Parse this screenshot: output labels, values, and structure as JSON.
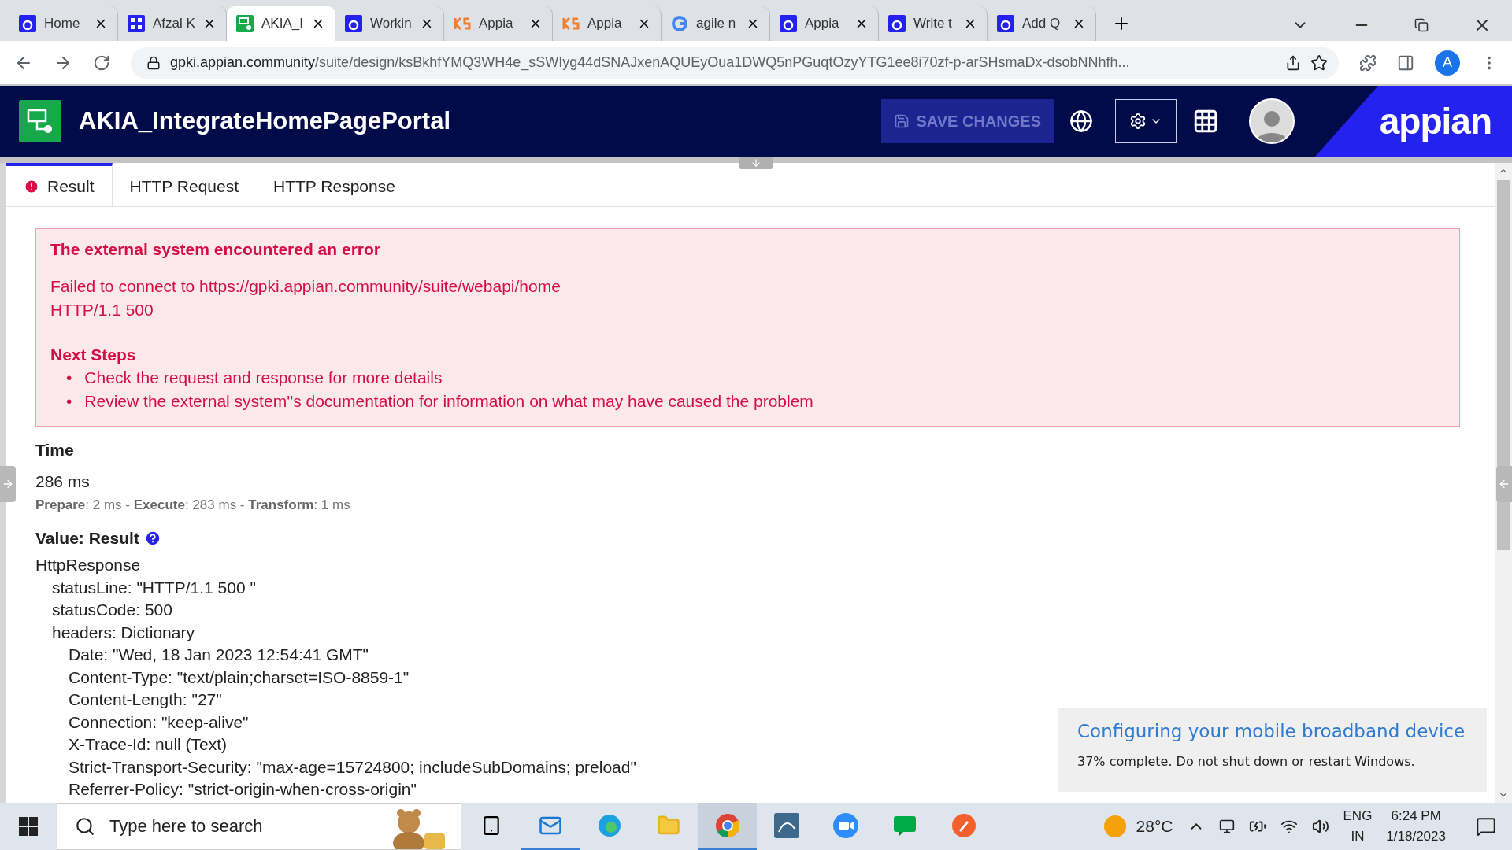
{
  "browser": {
    "tabs": [
      {
        "title": "Home",
        "selected": false,
        "kind": "appian"
      },
      {
        "title": "Afzal K",
        "selected": false,
        "kind": "grid"
      },
      {
        "title": "AKIA_I",
        "selected": true,
        "kind": "design"
      },
      {
        "title": "Workin",
        "selected": false,
        "kind": "appian"
      },
      {
        "title": "Appia",
        "selected": false,
        "kind": "ks"
      },
      {
        "title": "Appia",
        "selected": false,
        "kind": "ks"
      },
      {
        "title": "agile n",
        "selected": false,
        "kind": "google"
      },
      {
        "title": "Appia",
        "selected": false,
        "kind": "appian"
      },
      {
        "title": "Write t",
        "selected": false,
        "kind": "appian"
      },
      {
        "title": "Add Q",
        "selected": false,
        "kind": "appian"
      }
    ],
    "url_host": "gpki.appian.community",
    "url_path": "/suite/design/ksBkhfYMQ3WH4e_sSWIyg44dSNAJxenAQUEyOua1DWQ5nPGuqtOzyYTG1ee8i70zf-p-arSHsmaDx-dsobNNhfh...",
    "profile": "A"
  },
  "app": {
    "title": "AKIA_IntegrateHomePagePortal",
    "save_button": "SAVE CHANGES",
    "save_disabled": true,
    "logo": "appian"
  },
  "panel_tabs": [
    {
      "label": "Result",
      "selected": true,
      "error": true
    },
    {
      "label": "HTTP Request",
      "selected": false,
      "error": false
    },
    {
      "label": "HTTP Response",
      "selected": false,
      "error": false
    }
  ],
  "error_box": {
    "title": "The external system encountered an error",
    "lines": [
      "Failed to connect to https://gpki.appian.community/suite/webapi/home",
      "HTTP/1.1 500"
    ],
    "next_steps_title": "Next Steps",
    "bullet": "•",
    "steps": [
      "Check the request and response for more details",
      "Review the external system''s documentation for information on what may have caused the problem"
    ]
  },
  "time": {
    "heading": "Time",
    "total": "286 ms",
    "breakdown": "**Prepare**: 2 ms - **Execute**: 283 ms - **Transform**: 1 ms"
  },
  "value": {
    "heading": "Value: Result",
    "tree": {
      "text": "HttpResponse",
      "children": [
        {
          "text": "statusLine: \"HTTP/1.1 500 \""
        },
        {
          "text": "statusCode: 500"
        },
        {
          "text": "headers: Dictionary",
          "children": [
            {
              "text": "Date: \"Wed, 18 Jan 2023 12:54:41 GMT\""
            },
            {
              "text": "Content-Type: \"text/plain;charset=ISO-8859-1\""
            },
            {
              "text": "Content-Length: \"27\""
            },
            {
              "text": "Connection: \"keep-alive\""
            },
            {
              "text": "X-Trace-Id: null (Text)"
            },
            {
              "text": "Strict-Transport-Security: \"max-age=15724800; includeSubDomains; preload\""
            },
            {
              "text": "Referrer-Policy: \"strict-origin-when-cross-origin\""
            }
          ]
        }
      ]
    }
  },
  "notification": {
    "title": "Configuring your mobile broadband device",
    "message": "37% complete. Do not shut down or restart Windows."
  },
  "taskbar": {
    "search_placeholder": "Type here to search",
    "weather": "28°C",
    "language": "ENG",
    "region": "IN",
    "time": "6:24 PM",
    "date": "1/18/2023"
  }
}
